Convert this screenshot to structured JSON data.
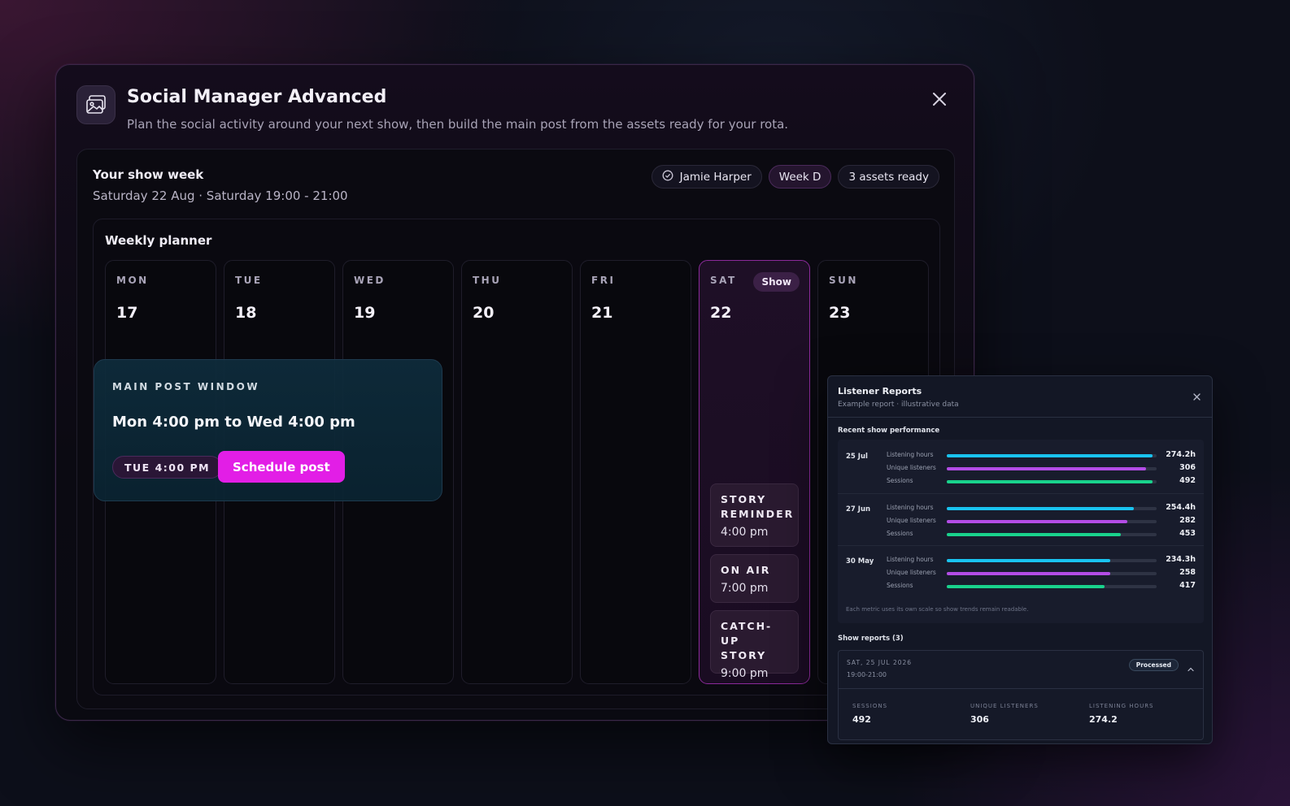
{
  "app": {
    "title": "Social Manager Advanced",
    "subtitle": "Plan the social activity around your next show, then build the main post from the assets ready for your rota."
  },
  "week": {
    "heading": "Your show week",
    "date_line": "Saturday 22 Aug · Saturday 19:00 - 21:00",
    "chips": {
      "presenter": "Jamie Harper",
      "week": "Week D",
      "assets": "3 assets ready"
    }
  },
  "planner": {
    "title": "Weekly planner",
    "days": [
      {
        "name": "MON",
        "num": "17"
      },
      {
        "name": "TUE",
        "num": "18"
      },
      {
        "name": "WED",
        "num": "19"
      },
      {
        "name": "THU",
        "num": "20"
      },
      {
        "name": "FRI",
        "num": "21"
      },
      {
        "name": "SAT",
        "num": "22"
      },
      {
        "name": "SUN",
        "num": "23"
      }
    ],
    "show_badge": "Show",
    "sat_events": [
      {
        "title": "STORY REMINDER",
        "time": "4:00 pm"
      },
      {
        "title": "ON AIR",
        "time": "7:00 pm"
      },
      {
        "title": "CATCH-UP STORY",
        "time": "9:00 pm"
      }
    ],
    "post_window": {
      "label": "MAIN POST WINDOW",
      "range": "Mon 4:00 pm to Wed 4:00 pm",
      "time_chip": "TUE 4:00 PM",
      "schedule_label": "Schedule post"
    }
  },
  "report": {
    "title": "Listener Reports",
    "subtitle": "Example report · illustrative data",
    "perf_heading": "Recent show performance",
    "metric_labels": {
      "hours": "Listening hours",
      "listeners": "Unique listeners",
      "sessions": "Sessions"
    },
    "colors": {
      "hours": "#19c3f0",
      "listeners": "#b34ce6",
      "sessions": "#19d28c"
    },
    "groups": [
      {
        "date": "25 Jul",
        "hours": "274.2h",
        "listeners": "306",
        "sessions": "492",
        "fill": {
          "hours": 0.98,
          "listeners": 0.95,
          "sessions": 0.98
        }
      },
      {
        "date": "27 Jun",
        "hours": "254.4h",
        "listeners": "282",
        "sessions": "453",
        "fill": {
          "hours": 0.89,
          "listeners": 0.86,
          "sessions": 0.83
        }
      },
      {
        "date": "30 May",
        "hours": "234.3h",
        "listeners": "258",
        "sessions": "417",
        "fill": {
          "hours": 0.78,
          "listeners": 0.78,
          "sessions": 0.75
        }
      }
    ],
    "note": "Each metric uses its own scale so show trends remain readable.",
    "shows_heading": "Show reports (3)",
    "show_report": {
      "date": "SAT, 25 JUL 2026",
      "time": "19:00-21:00",
      "badge": "Processed",
      "stats": [
        {
          "label": "SESSIONS",
          "value": "492"
        },
        {
          "label": "UNIQUE LISTENERS",
          "value": "306"
        },
        {
          "label": "LISTENING HOURS",
          "value": "274.2"
        }
      ]
    }
  }
}
